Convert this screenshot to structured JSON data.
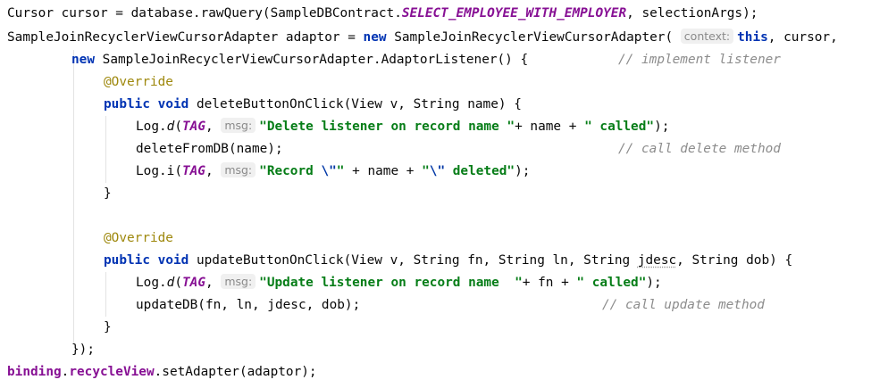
{
  "code": {
    "l1": {
      "decl": "Cursor cursor = database.rawQuery(SampleDBContract.",
      "constant": "SELECT_EMPLOYEE_WITH_EMPLOYER",
      "rest": ", selectionArgs);"
    },
    "l2": {
      "decl": "SampleJoinRecyclerViewCursorAdapter adaptor = ",
      "kw_new": "new",
      "call": " SampleJoinRecyclerViewCursorAdapter(",
      "hint": "context:",
      "kw_this": "this",
      "rest": ", cursor,"
    },
    "l3": {
      "kw_new": "new",
      "type": " SampleJoinRecyclerViewCursorAdapter.AdaptorListener() {",
      "comment": "// implement listener"
    },
    "l4": {
      "annotation": "@Override"
    },
    "l5": {
      "kw_public": "public",
      "kw_void": "void",
      "sig": " deleteButtonOnClick(View v, String name) {"
    },
    "l6": {
      "pre": "Log.",
      "method": "d",
      "paren": "(",
      "tag": "TAG",
      "comma": ", ",
      "hint": "msg:",
      "str1": "\"Delete listener on record name \"",
      "mid": "+ name + ",
      "str2": "\" called\"",
      "end": ");"
    },
    "l7": {
      "code": "deleteFromDB(name);",
      "comment": "// call delete method"
    },
    "l8": {
      "pre": "Log.i(",
      "tag": "TAG",
      "comma": ", ",
      "hint": "msg:",
      "str1a": "\"Record ",
      "esc1": "\\\"",
      "str1b": "\"",
      "mid": " + name + ",
      "str2a": "\"",
      "esc2": "\\\"",
      "str2b": " deleted\"",
      "end": ");"
    },
    "l9": {
      "brace": "}"
    },
    "l11": {
      "annotation": "@Override"
    },
    "l12": {
      "kw_public": "public",
      "kw_void": "void",
      "sig_a": " updateButtonOnClick(View v, String fn, String ln, String ",
      "typo": "jdesc",
      "sig_b": ", String dob) {"
    },
    "l13": {
      "pre": "Log.",
      "method": "d",
      "paren": "(",
      "tag": "TAG",
      "comma": ", ",
      "hint": "msg:",
      "str1": "\"Update listener on record name  \"",
      "mid": "+ fn + ",
      "str2": "\" called\"",
      "end": ");"
    },
    "l14": {
      "code": "updateDB(fn, ln, jdesc, dob);",
      "comment": "// call update method"
    },
    "l15": {
      "brace": "}"
    },
    "l16": {
      "code": "});"
    },
    "l17": {
      "binding": "binding",
      "dot": ".",
      "field": "recycleView",
      "rest": ".setAdapter(adaptor);"
    }
  }
}
